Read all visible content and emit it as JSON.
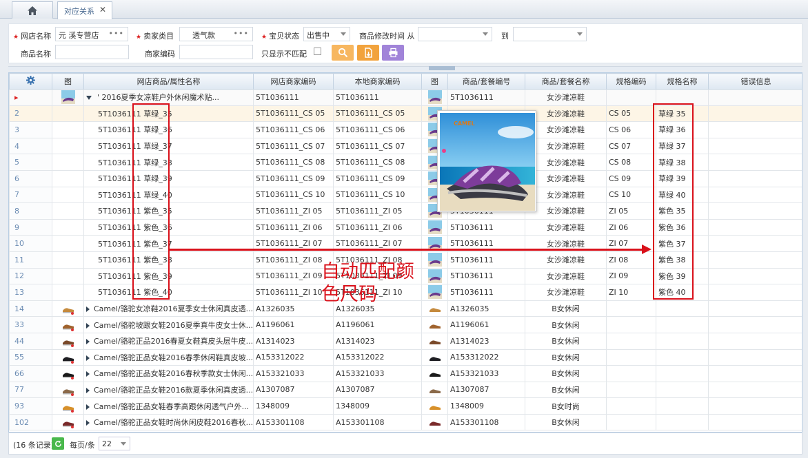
{
  "tabs": {
    "active_label": "对应关系",
    "close_glyph": "✕"
  },
  "filters": {
    "shop_name_label": "网店名称",
    "shop_name_value": "元     溪专营店",
    "seller_cat_label": "卖家类目",
    "seller_cat_value": "透气款",
    "status_label": "宝贝状态",
    "status_value": "出售中",
    "modified_label": "商品修改时间 从",
    "to_label": "到",
    "product_name_label": "商品名称",
    "merchant_code_label": "商家编码",
    "unmatched_label": "只显示不匹配",
    "dots": "•••"
  },
  "colors": {
    "accent": "#4a6a91",
    "search_btn": "#f7b760",
    "export_btn": "#f2a33d",
    "print_btn": "#a184d9",
    "highlight": "#d9101a"
  },
  "grid": {
    "headers": [
      "图",
      "网店商品/属性名称",
      "网店商家编码",
      "本地商家编码",
      "图",
      "商品/套餐编号",
      "商品/套餐名称",
      "规格编码",
      "规格名称",
      "错误信息"
    ],
    "parent_row": {
      "num": "",
      "name": "'               2016夏季女凉鞋户外休闲魔术贴...",
      "shop_code": "5T1036111",
      "local_code": "5T1036111",
      "pkg_no": "5T1036111",
      "pkg_name": "女沙滩凉鞋",
      "spec_code": "",
      "spec_name": ""
    },
    "sub_rows": [
      {
        "num": "2",
        "name": "5T1036111 草绿_35",
        "shop_code": "5T1036111_CS 05",
        "local_code": "5T1036111_CS 05",
        "pkg_no": "5T1036111",
        "pkg_name": "女沙滩凉鞋",
        "spec_code": "CS 05",
        "spec_name": "草绿 35"
      },
      {
        "num": "3",
        "name": "5T1036111 草绿_36",
        "shop_code": "5T1036111_CS 06",
        "local_code": "5T1036111_CS 06",
        "pkg_no": "5T1036111",
        "pkg_name": "女沙滩凉鞋",
        "spec_code": "CS 06",
        "spec_name": "草绿 36"
      },
      {
        "num": "4",
        "name": "5T1036111 草绿_37",
        "shop_code": "5T1036111_CS 07",
        "local_code": "5T1036111_CS 07",
        "pkg_no": "5T1036111",
        "pkg_name": "女沙滩凉鞋",
        "spec_code": "CS 07",
        "spec_name": "草绿 37"
      },
      {
        "num": "5",
        "name": "5T1036111 草绿_38",
        "shop_code": "5T1036111_CS 08",
        "local_code": "5T1036111_CS 08",
        "pkg_no": "5T1036111",
        "pkg_name": "女沙滩凉鞋",
        "spec_code": "CS 08",
        "spec_name": "草绿 38"
      },
      {
        "num": "6",
        "name": "5T1036111 草绿_39",
        "shop_code": "5T1036111_CS 09",
        "local_code": "5T1036111_CS 09",
        "pkg_no": "5T1036111",
        "pkg_name": "女沙滩凉鞋",
        "spec_code": "CS 09",
        "spec_name": "草绿 39"
      },
      {
        "num": "7",
        "name": "5T1036111 草绿_40",
        "shop_code": "5T1036111_CS 10",
        "local_code": "5T1036111_CS 10",
        "pkg_no": "5T1036111",
        "pkg_name": "女沙滩凉鞋",
        "spec_code": "CS 10",
        "spec_name": "草绿 40"
      },
      {
        "num": "8",
        "name": "5T1036111 紫色_35",
        "shop_code": "5T1036111_ZI 05",
        "local_code": "5T1036111_ZI 05",
        "pkg_no": "5T1036111",
        "pkg_name": "女沙滩凉鞋",
        "spec_code": "ZI 05",
        "spec_name": "紫色 35"
      },
      {
        "num": "9",
        "name": "5T1036111 紫色_36",
        "shop_code": "5T1036111_ZI 06",
        "local_code": "5T1036111_ZI 06",
        "pkg_no": "5T1036111",
        "pkg_name": "女沙滩凉鞋",
        "spec_code": "ZI 06",
        "spec_name": "紫色 36"
      },
      {
        "num": "10",
        "name": "5T1036111 紫色_37",
        "shop_code": "5T1036111_ZI 07",
        "local_code": "5T1036111_ZI 07",
        "pkg_no": "5T1036111",
        "pkg_name": "女沙滩凉鞋",
        "spec_code": "ZI 07",
        "spec_name": "紫色 37"
      },
      {
        "num": "11",
        "name": "5T1036111 紫色_38",
        "shop_code": "5T1036111_ZI 08",
        "local_code": "5T1036111_ZI 08",
        "pkg_no": "5T1036111",
        "pkg_name": "女沙滩凉鞋",
        "spec_code": "ZI 08",
        "spec_name": "紫色 38"
      },
      {
        "num": "12",
        "name": "5T1036111 紫色_39",
        "shop_code": "5T1036111_ZI 09",
        "local_code": "5T1036111_ZI 09",
        "pkg_no": "5T1036111",
        "pkg_name": "女沙滩凉鞋",
        "spec_code": "ZI 09",
        "spec_name": "紫色 39"
      },
      {
        "num": "13",
        "name": "5T1036111 紫色_40",
        "shop_code": "5T1036111_ZI 10",
        "local_code": "5T1036111_ZI 10",
        "pkg_no": "5T1036111",
        "pkg_name": "女沙滩凉鞋",
        "spec_code": "ZI 10",
        "spec_name": "紫色 40"
      }
    ],
    "product_rows": [
      {
        "num": "14",
        "name": "Camel/骆驼女凉鞋2016夏季女士休闲真皮透...",
        "shop_code": "A1326035",
        "local_code": "A1326035",
        "pkg_no": "A1326035",
        "pkg_name": "B女休闲"
      },
      {
        "num": "33",
        "name": "Camel/骆驼坡跟女鞋2016夏季真牛皮女士休...",
        "shop_code": "A1196061",
        "local_code": "A1196061",
        "pkg_no": "A1196061",
        "pkg_name": "B女休闲"
      },
      {
        "num": "44",
        "name": "Camel/骆驼正品2016春夏女鞋真皮头层牛皮...",
        "shop_code": "A1314023",
        "local_code": "A1314023",
        "pkg_no": "A1314023",
        "pkg_name": "B女休闲"
      },
      {
        "num": "55",
        "name": "Camel/骆驼正品女鞋2016春季休闲鞋真皮坡...",
        "shop_code": "A153312022",
        "local_code": "A153312022",
        "pkg_no": "A153312022",
        "pkg_name": "B女休闲"
      },
      {
        "num": "66",
        "name": "Camel/骆驼正品女鞋2016春秋季款女士休闲...",
        "shop_code": "A153321033",
        "local_code": "A153321033",
        "pkg_no": "A153321033",
        "pkg_name": "B女休闲"
      },
      {
        "num": "77",
        "name": "Camel/骆驼正品女鞋2016款夏季休闲真皮透...",
        "shop_code": "A1307087",
        "local_code": "A1307087",
        "pkg_no": "A1307087",
        "pkg_name": "B女休闲"
      },
      {
        "num": "93",
        "name": "Camel/骆驼正品女鞋春季高跟休闲透气户外...",
        "shop_code": "1348009",
        "local_code": "1348009",
        "pkg_no": "1348009",
        "pkg_name": "B女时尚"
      },
      {
        "num": "102",
        "name": "Camel/骆驼正品女鞋时尚休闲皮鞋2016春秋...",
        "shop_code": "A153301108",
        "local_code": "A153301108",
        "pkg_no": "A153301108",
        "pkg_name": "B女休闲"
      }
    ]
  },
  "popup": {
    "brand": "CAMEL"
  },
  "annotation": {
    "line1": "自动匹配颜",
    "line2": "色尺码"
  },
  "footer": {
    "records": "(16 条记录)",
    "per_page_label": "每页/条",
    "per_page_value": "22"
  }
}
